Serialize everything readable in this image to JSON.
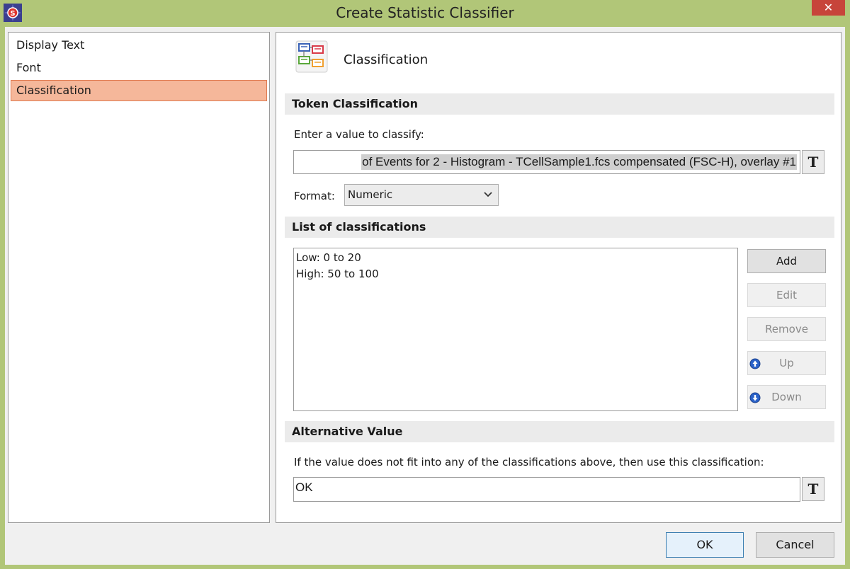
{
  "window": {
    "title": "Create Statistic Classifier",
    "close_glyph": "✕"
  },
  "nav": {
    "items": [
      "Display Text",
      "Font",
      "Classification"
    ],
    "selected": "Classification"
  },
  "header": {
    "title": "Classification",
    "icon": "classification-tree-icon"
  },
  "token_section": {
    "heading": "Token Classification",
    "prompt": "Enter a value to classify:",
    "value": "of Events for 2 - Histogram - TCellSample1.fcs compensated (FSC-H), overlay #1",
    "token_button": "T",
    "format_label": "Format:",
    "format_value": "Numeric"
  },
  "list_section": {
    "heading": "List of classifications",
    "items": [
      "Low: 0 to 20",
      "High: 50 to 100"
    ],
    "buttons": {
      "add": "Add",
      "edit": "Edit",
      "remove": "Remove",
      "up": "Up",
      "down": "Down"
    }
  },
  "alt_section": {
    "heading": "Alternative Value",
    "prompt": "If the value does not fit into any of the classifications above, then use this classification:",
    "value": "OK",
    "token_button": "T"
  },
  "footer": {
    "ok": "OK",
    "cancel": "Cancel"
  },
  "colors": {
    "titlebar": "#b1c678",
    "selection": "#f5b79a",
    "close": "#c7443a"
  }
}
